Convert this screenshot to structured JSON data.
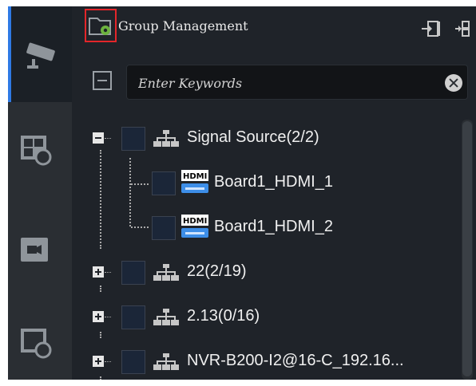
{
  "header": {
    "title": "Group Management"
  },
  "search": {
    "placeholder": "Enter Keywords"
  },
  "tree": {
    "items": [
      {
        "label": "Signal Source(2/2)"
      },
      {
        "label": "Board1_HDMI_1",
        "badge": "HDMI"
      },
      {
        "label": "Board1_HDMI_2",
        "badge": "HDMI"
      },
      {
        "label": "22(2/19)"
      },
      {
        "label": "2.13(0/16)"
      },
      {
        "label": "NVR-B200-I2@16-C_192.16..."
      }
    ]
  },
  "colors": {
    "accent": "#2f7ae5",
    "highlight_box": "#e3262a",
    "gear": "#6db33f"
  }
}
